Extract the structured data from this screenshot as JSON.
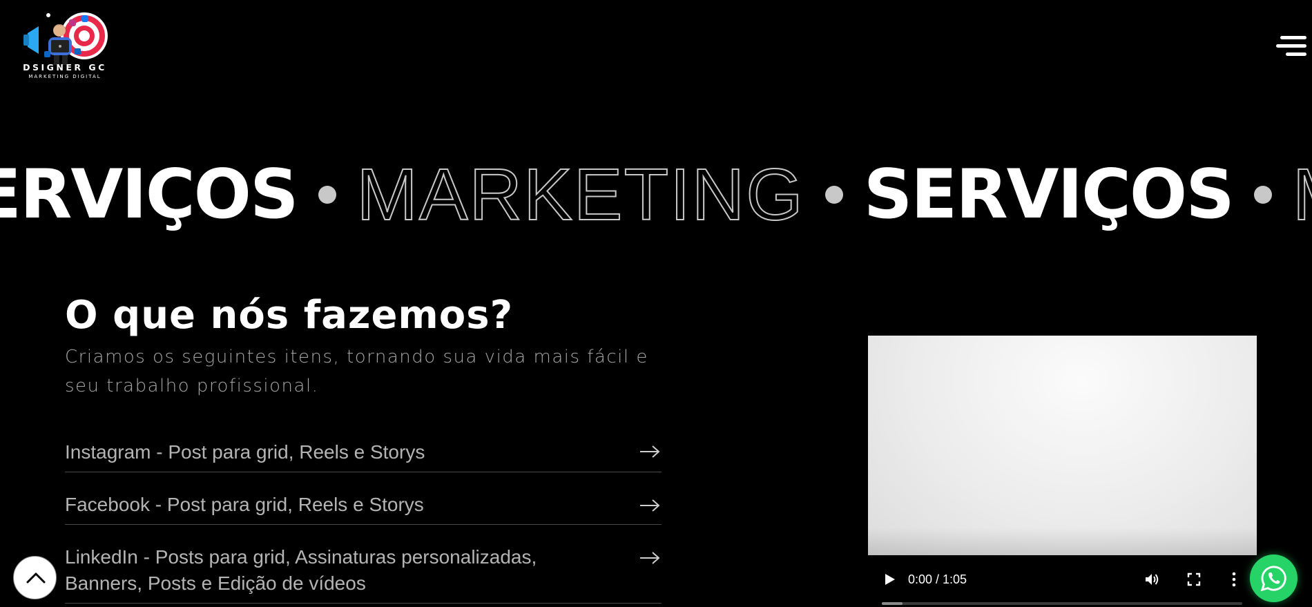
{
  "header": {
    "logo_brand": "DSIGNER GC",
    "logo_tagline": "MARKETING DIGITAL",
    "menu_icon": "hamburger-menu-icon"
  },
  "marquee": {
    "word_bold": "SERVIÇOS",
    "word_light": "MARKETING",
    "word_bold_partial": "ERVIÇOS",
    "word_light_partial": "MAR"
  },
  "services": {
    "title": "O que nós fazemos?",
    "subtitle": "Criamos os seguintes itens, tornando sua vida mais fácil e seu trabalho profissional.",
    "items": [
      {
        "label": "Instagram - Post para grid, Reels e Storys",
        "icon": "arrow-right-icon"
      },
      {
        "label": "Facebook - Post para grid, Reels e Storys",
        "icon": "arrow-right-icon"
      },
      {
        "label": "LinkedIn - Posts para grid, Assinaturas personalizadas, Banners, Posts e Edição de vídeos",
        "icon": "arrow-right-icon"
      }
    ]
  },
  "video": {
    "time": "0:00 / 1:05",
    "progress": 0,
    "icons": [
      "play-icon",
      "volume-icon",
      "fullscreen-icon",
      "more-options-icon"
    ]
  },
  "floating": {
    "back_to_top_icon": "chevron-up-icon",
    "whatsapp_icon": "whatsapp-icon"
  },
  "colors": {
    "background": "#000000",
    "text_primary": "#ffffff",
    "text_muted": "#a6a6a6",
    "whatsapp_green": "#25d366"
  }
}
